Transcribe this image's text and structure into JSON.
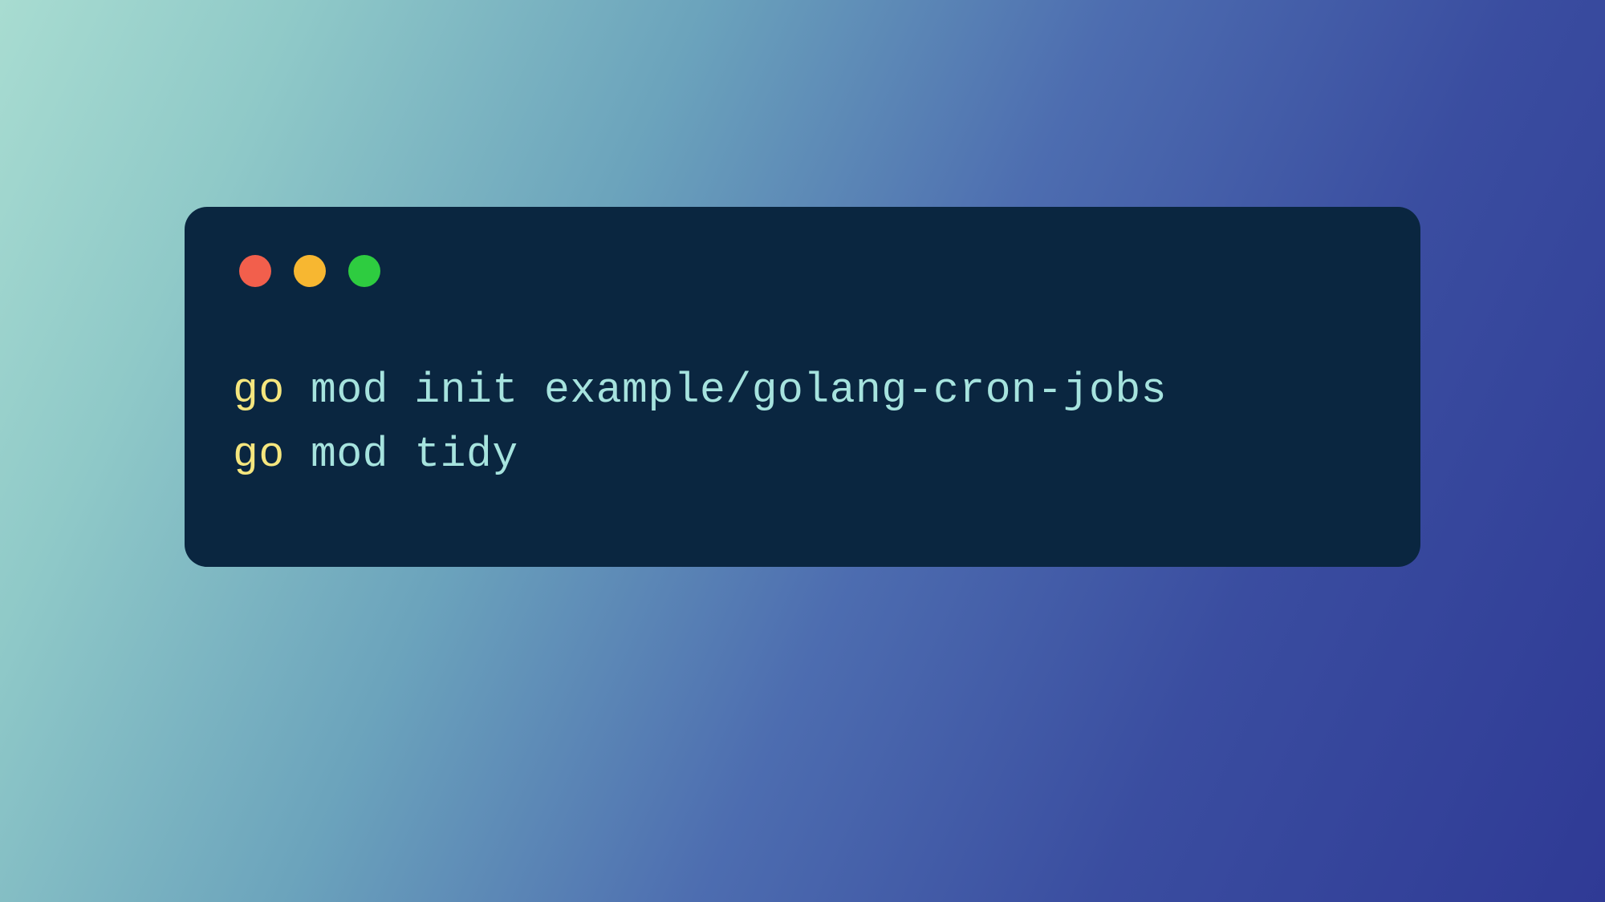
{
  "terminal": {
    "lines": [
      {
        "keyword": "go",
        "rest": " mod init example/golang-cron-jobs"
      },
      {
        "keyword": "go",
        "rest": " mod tidy"
      }
    ]
  },
  "colors": {
    "terminal_bg": "#0a2640",
    "keyword": "#f5e67e",
    "command": "#a6e3de",
    "traffic_red": "#f25f4c",
    "traffic_yellow": "#f7b731",
    "traffic_green": "#2ecc40"
  }
}
